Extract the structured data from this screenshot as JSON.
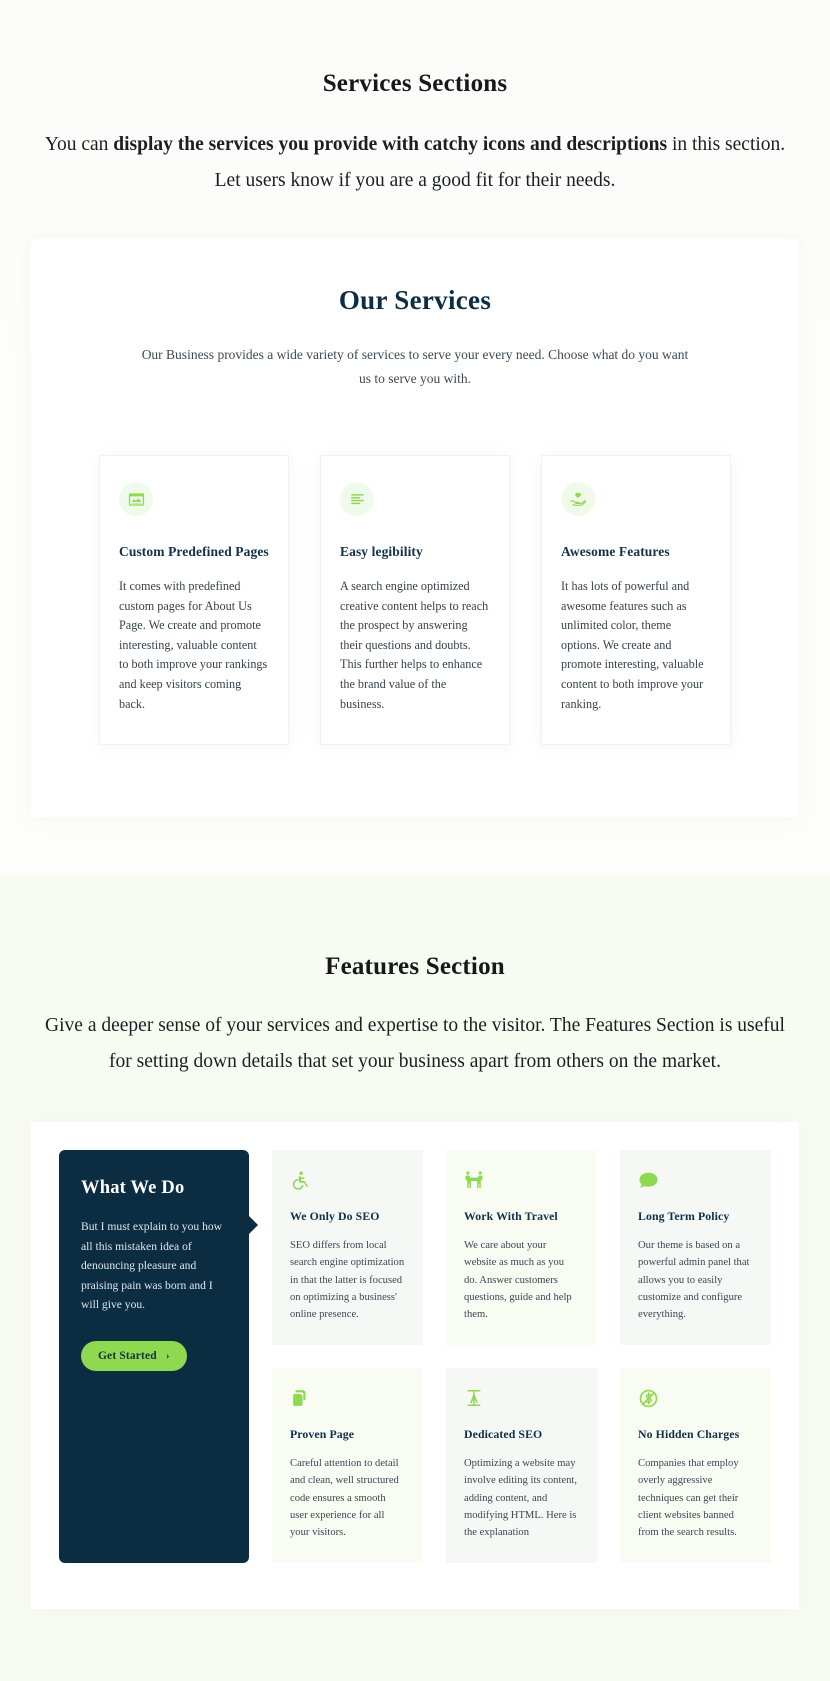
{
  "colors": {
    "accent_green": "#8ed94f",
    "dark_navy": "#0b2c41",
    "heading_navy": "#0d2d44",
    "page_bg": "#fbfcf9",
    "features_bg": "#f8fbf2"
  },
  "services_intro": {
    "title": "Services Sections",
    "text_before": "You can ",
    "text_bold": "display the services you provide with catchy icons and descriptions",
    "text_after": " in this section. Let users know if you are a good fit for their needs."
  },
  "services_block": {
    "heading": "Our Services",
    "subheading": "Our Business provides a wide variety of services to serve your every need. Choose what do you want us to serve you with.",
    "cards": [
      {
        "icon": "browser-window-icon",
        "title": "Custom Predefined Pages",
        "desc": "It comes with predefined custom pages for About Us Page. We create and promote interesting, valuable content to both improve your rankings and keep visitors coming back."
      },
      {
        "icon": "align-left-text-icon",
        "title": "Easy legibility",
        "desc": "A search engine optimized creative content helps to reach the prospect by answering their questions and doubts. This further helps to enhance the brand value of the business."
      },
      {
        "icon": "hand-holding-heart-icon",
        "title": "Awesome Features",
        "desc": "It has lots of powerful and awesome features such as unlimited color, theme options. We create and promote interesting, valuable content to both improve your ranking."
      }
    ]
  },
  "features_intro": {
    "title": "Features Section",
    "text": "Give a deeper sense of your services and expertise to the visitor. The Features Section is useful for setting down details that set your business apart from others on the market."
  },
  "features_block": {
    "promo": {
      "title": "What We Do",
      "text": "But I must explain to you how all this mistaken idea of denouncing pleasure and praising pain was born and I will give you.",
      "button_label": "Get Started",
      "button_chevron": "›"
    },
    "cards": [
      {
        "icon": "accessibility-icon",
        "title": "We Only Do SEO",
        "desc": "SEO differs from local search engine optimization in that the latter is focused on optimizing a business' online presence.",
        "tint": "gray"
      },
      {
        "icon": "people-carry-icon",
        "title": "Work With Travel",
        "desc": "We care about your website as much as you do. Answer customers questions, guide and help them.",
        "tint": "green"
      },
      {
        "icon": "comment-bubble-icon",
        "title": "Long Term Policy",
        "desc": "Our theme is based on a powerful admin panel that allows you to easily customize and configure everything.",
        "tint": "gray"
      },
      {
        "icon": "clone-pages-icon",
        "title": "Proven Page",
        "desc": "Careful attention to detail and clean, well structured code ensures a smooth user experience for all your visitors.",
        "tint": "green"
      },
      {
        "icon": "text-height-icon",
        "title": "Dedicated SEO",
        "desc": "Optimizing a website may involve editing its content, adding content, and modifying HTML. Here is the explanation",
        "tint": "gray"
      },
      {
        "icon": "no-money-circle-icon",
        "title": "No Hidden Charges",
        "desc": "Companies that employ overly aggressive techniques can get their client websites banned from the search results.",
        "tint": "green"
      }
    ]
  }
}
